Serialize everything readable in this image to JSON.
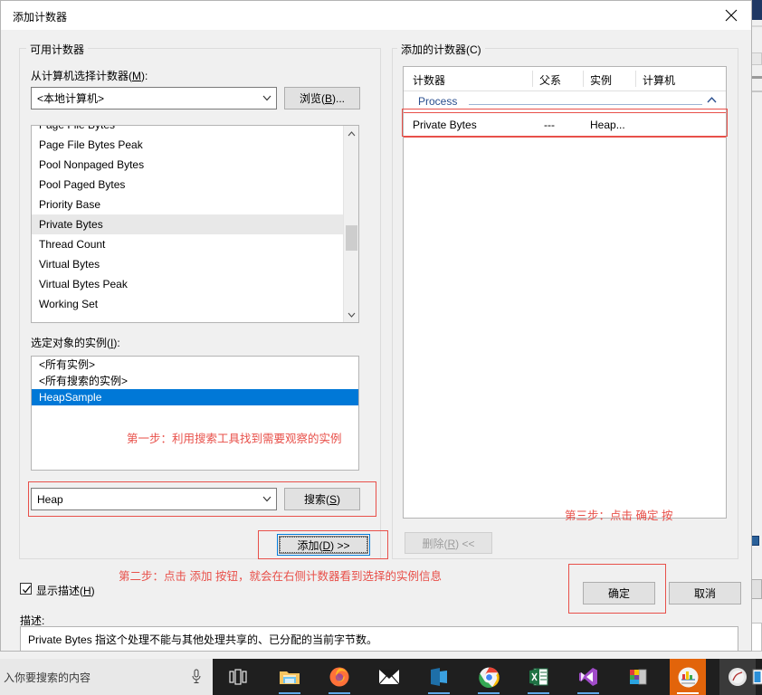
{
  "dialog": {
    "title": "添加计数器",
    "close_icon": "close-icon"
  },
  "available_counters": {
    "group_label": "可用计数器",
    "source_label": "从计算机选择计数器(M):",
    "source_value": "<本地计算机>",
    "browse_button": "浏览(B)...",
    "counter_list": [
      "Page File Bytes",
      "Page File Bytes Peak",
      "Pool Nonpaged Bytes",
      "Pool Paged Bytes",
      "Priority Base",
      "Private Bytes",
      "Thread Count",
      "Virtual Bytes",
      "Virtual Bytes Peak",
      "Working Set"
    ],
    "selected_counter": "Private Bytes",
    "instances_label": "选定对象的实例(I):",
    "instance_list": [
      "<所有实例>",
      "<所有搜索的实例>",
      "HeapSample"
    ],
    "selected_instance": "HeapSample",
    "search_value": "Heap",
    "search_button": "搜索(S)",
    "add_button": "添加(D) >>"
  },
  "added_counters": {
    "group_label": "添加的计数器(C)",
    "columns": [
      "计数器",
      "父系",
      "实例",
      "计算机"
    ],
    "group_row": "Process",
    "rows": [
      {
        "counter": "Private Bytes",
        "parent": "---",
        "instance": "Heap...",
        "computer": ""
      }
    ],
    "remove_button": "删除(R) <<"
  },
  "footer": {
    "show_description_label": "显示描述(H)",
    "show_description_checked": true,
    "description_label": "描述:",
    "description_text": "Private Bytes 指这个处理不能与其他处理共享的、已分配的当前字节数。",
    "ok_button": "确定",
    "cancel_button": "取消"
  },
  "annotations": {
    "step1": "第一步：利用搜索工具找到需要观察的实例",
    "step2": "第二步：点击 添加 按钮，就会在右侧计数器看到选择的实例信息",
    "step3": "第三步：点击 确定 按",
    "highlight_color": "#e8504a"
  },
  "taskbar": {
    "search_placeholder": "入你要搜索的内容",
    "mic_icon": "microphone-icon",
    "items": [
      {
        "name": "task-view-icon",
        "label": "任务视图"
      },
      {
        "name": "file-explorer-icon",
        "label": "文件资源管理器"
      },
      {
        "name": "firefox-icon",
        "label": "Firefox"
      },
      {
        "name": "mail-icon",
        "label": "邮件"
      },
      {
        "name": "onenote-icon",
        "label": "OneNote"
      },
      {
        "name": "chrome-icon",
        "label": "Google Chrome"
      },
      {
        "name": "excel-icon",
        "label": "Excel"
      },
      {
        "name": "visual-studio-icon",
        "label": "Visual Studio"
      },
      {
        "name": "paint-icon",
        "label": "画图"
      },
      {
        "name": "perfmon-icon",
        "label": "性能监视器"
      },
      {
        "name": "media-icon",
        "label": "媒体播放器"
      },
      {
        "name": "notes-icon",
        "label": "便笺"
      }
    ]
  }
}
